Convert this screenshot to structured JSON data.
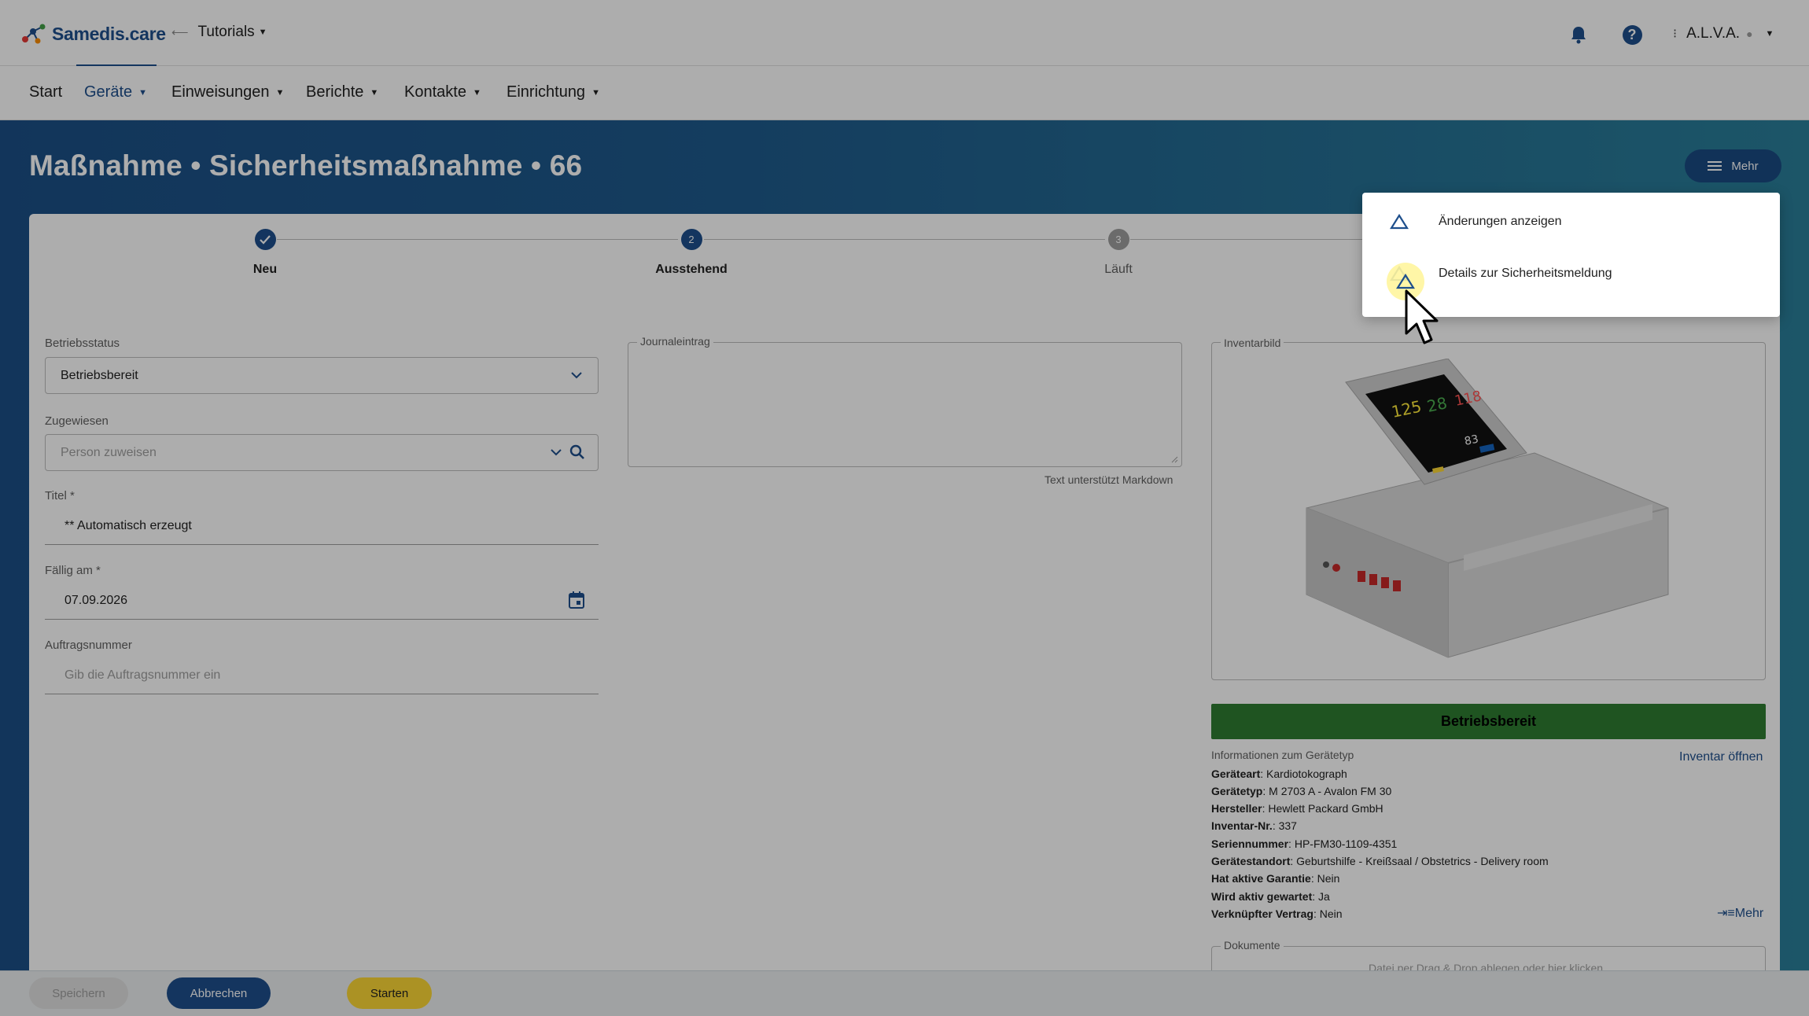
{
  "header": {
    "brand": "Samedis.care",
    "tenant": "Tutorials",
    "user": "A.L.V.A."
  },
  "nav": {
    "items": [
      "Start",
      "Geräte",
      "Einweisungen",
      "Berichte",
      "Kontakte",
      "Einrichtung"
    ],
    "active": "Geräte"
  },
  "page": {
    "title": "Maßnahme • Sicherheitsmaßnahme • 66",
    "more_button": "Mehr"
  },
  "stepper": {
    "steps": [
      {
        "label": "Neu",
        "state": "done",
        "number": ""
      },
      {
        "label": "Ausstehend",
        "state": "active",
        "number": "2"
      },
      {
        "label": "Läuft",
        "state": "pending",
        "number": "3"
      }
    ]
  },
  "form": {
    "betriebsstatus": {
      "label": "Betriebsstatus",
      "value": "Betriebsbereit"
    },
    "zugewiesen": {
      "label": "Zugewiesen",
      "placeholder": "Person zuweisen"
    },
    "titel": {
      "label": "Titel *",
      "value": "** Automatisch erzeugt"
    },
    "faellig": {
      "label": "Fällig am *",
      "value": "07.09.2026"
    },
    "auftragsnummer": {
      "label": "Auftragsnummer",
      "placeholder": "Gib die Auftragsnummer ein"
    },
    "journal": {
      "label": "Journaleintrag",
      "hint": "Text unterstützt Markdown"
    }
  },
  "inventory": {
    "image_label": "Inventarbild",
    "status": "Betriebsbereit",
    "info_heading": "Informationen zum Gerätetyp",
    "open_link": "Inventar öffnen",
    "details": [
      {
        "key": "Geräteart",
        "value": "Kardiotokograph"
      },
      {
        "key": "Gerätetyp",
        "value": "M 2703 A - Avalon FM 30"
      },
      {
        "key": "Hersteller",
        "value": "Hewlett Packard GmbH"
      },
      {
        "key": "Inventar-Nr.",
        "value": "337"
      },
      {
        "key": "Seriennummer",
        "value": "HP-FM30-1109-4351"
      },
      {
        "key": "Gerätestandort",
        "value": "Geburtshilfe - Kreißsaal / Obstetrics - Delivery room"
      },
      {
        "key": "Hat aktive Garantie",
        "value": "Nein"
      },
      {
        "key": "Wird aktiv gewartet",
        "value": "Ja"
      },
      {
        "key": "Verknüpfter Vertrag",
        "value": "Nein"
      }
    ],
    "more_link": "Mehr",
    "docs_label": "Dokumente",
    "docs_hint": "Datei per Drag & Drop ablegen oder hier klicken"
  },
  "actions": {
    "save": "Speichern",
    "cancel": "Abbrechen",
    "start": "Starten"
  },
  "popup_menu": {
    "items": [
      {
        "label": "Änderungen anzeigen",
        "icon": "warning-triangle-icon"
      },
      {
        "label": "Details zur Sicherheitsmeldung",
        "icon": "warning-triangle-icon"
      }
    ]
  },
  "colors": {
    "brand": "#1e4f8c",
    "status_ok": "#2e7d32",
    "start_button": "#fdd835"
  }
}
